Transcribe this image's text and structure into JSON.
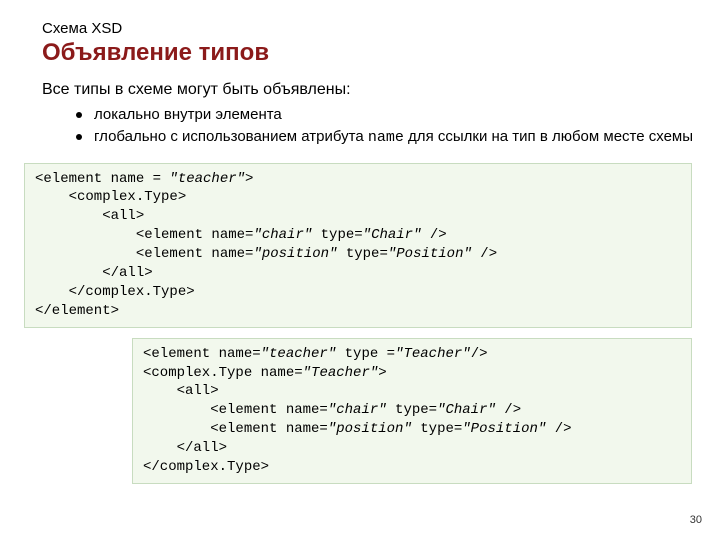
{
  "schema_label": "Схема XSD",
  "title": "Объявление типов",
  "intro": "Все типы в схеме могут быть объявлены:",
  "bullet1": "локально внутри элемента",
  "bullet2_a": "глобально с использованием атрибута ",
  "bullet2_mono": "name",
  "bullet2_b": "  для ссылки на тип в любом месте схемы",
  "code1": {
    "l1a": "<element name = ",
    "l1b": "\"teacher\"",
    "l1c": ">",
    "l2": "    <complex.Type>",
    "l3": "        <all>",
    "l4a": "            <element name=",
    "l4b": "\"chair\"",
    "l4c": " type=",
    "l4d": "\"Chair\"",
    "l4e": " />",
    "l5a": "            <element name=",
    "l5b": "\"position\"",
    "l5c": " type=",
    "l5d": "\"Position\"",
    "l5e": " />",
    "l6": "        </all>",
    "l7": "    </complex.Type>",
    "l8": "</element>"
  },
  "code2": {
    "l1a": "<element name=",
    "l1b": "\"teacher\"",
    "l1c": " type =",
    "l1d": "\"Teacher\"",
    "l1e": "/>",
    "l2a": "<complex.Type name=",
    "l2b": "\"Teacher\"",
    "l2c": ">",
    "l3": "    <all>",
    "l4a": "        <element name=",
    "l4b": "\"chair\"",
    "l4c": " type=",
    "l4d": "\"Chair\"",
    "l4e": " />",
    "l5a": "        <element name=",
    "l5b": "\"position\"",
    "l5c": " type=",
    "l5d": "\"Position\"",
    "l5e": " />",
    "l6": "    </all>",
    "l7": "</complex.Type>"
  },
  "pagenum": "30"
}
